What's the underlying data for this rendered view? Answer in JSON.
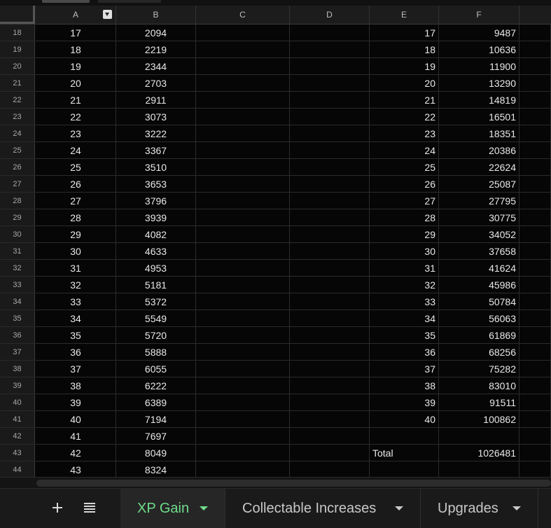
{
  "columns": [
    "A",
    "B",
    "C",
    "D",
    "E",
    "F"
  ],
  "rows": [
    {
      "num": "18",
      "a": "17",
      "b": "2094",
      "e": "17",
      "f": "9487"
    },
    {
      "num": "19",
      "a": "18",
      "b": "2219",
      "e": "18",
      "f": "10636"
    },
    {
      "num": "20",
      "a": "19",
      "b": "2344",
      "e": "19",
      "f": "11900"
    },
    {
      "num": "21",
      "a": "20",
      "b": "2703",
      "e": "20",
      "f": "13290"
    },
    {
      "num": "22",
      "a": "21",
      "b": "2911",
      "e": "21",
      "f": "14819"
    },
    {
      "num": "23",
      "a": "22",
      "b": "3073",
      "e": "22",
      "f": "16501"
    },
    {
      "num": "24",
      "a": "23",
      "b": "3222",
      "e": "23",
      "f": "18351"
    },
    {
      "num": "25",
      "a": "24",
      "b": "3367",
      "e": "24",
      "f": "20386"
    },
    {
      "num": "26",
      "a": "25",
      "b": "3510",
      "e": "25",
      "f": "22624"
    },
    {
      "num": "27",
      "a": "26",
      "b": "3653",
      "e": "26",
      "f": "25087"
    },
    {
      "num": "28",
      "a": "27",
      "b": "3796",
      "e": "27",
      "f": "27795"
    },
    {
      "num": "29",
      "a": "28",
      "b": "3939",
      "e": "28",
      "f": "30775"
    },
    {
      "num": "30",
      "a": "29",
      "b": "4082",
      "e": "29",
      "f": "34052"
    },
    {
      "num": "31",
      "a": "30",
      "b": "4633",
      "e": "30",
      "f": "37658"
    },
    {
      "num": "32",
      "a": "31",
      "b": "4953",
      "e": "31",
      "f": "41624"
    },
    {
      "num": "33",
      "a": "32",
      "b": "5181",
      "e": "32",
      "f": "45986"
    },
    {
      "num": "34",
      "a": "33",
      "b": "5372",
      "e": "33",
      "f": "50784"
    },
    {
      "num": "35",
      "a": "34",
      "b": "5549",
      "e": "34",
      "f": "56063"
    },
    {
      "num": "36",
      "a": "35",
      "b": "5720",
      "e": "35",
      "f": "61869"
    },
    {
      "num": "37",
      "a": "36",
      "b": "5888",
      "e": "36",
      "f": "68256"
    },
    {
      "num": "38",
      "a": "37",
      "b": "6055",
      "e": "37",
      "f": "75282"
    },
    {
      "num": "39",
      "a": "38",
      "b": "6222",
      "e": "38",
      "f": "83010"
    },
    {
      "num": "40",
      "a": "39",
      "b": "6389",
      "e": "39",
      "f": "91511"
    },
    {
      "num": "41",
      "a": "40",
      "b": "7194",
      "e": "40",
      "f": "100862"
    },
    {
      "num": "42",
      "a": "41",
      "b": "7697",
      "e": "",
      "f": ""
    },
    {
      "num": "43",
      "a": "42",
      "b": "8049",
      "e": "Total",
      "f": "1026481"
    },
    {
      "num": "44",
      "a": "43",
      "b": "8324",
      "e": "",
      "f": ""
    }
  ],
  "sheet_tabs": [
    {
      "label": "XP Gain",
      "active": true
    },
    {
      "label": "Collectable Increases",
      "active": false
    },
    {
      "label": "Upgrades",
      "active": false
    }
  ],
  "icons": {
    "add_sheet": "plus-icon",
    "all_sheets": "list-icon",
    "filter": "filter-dropdown-icon",
    "tab_menu": "caret-down-icon"
  },
  "colors": {
    "background": "#060606",
    "active_tab_text": "#6fdc8c",
    "header_bg": "#1c1c1c"
  }
}
